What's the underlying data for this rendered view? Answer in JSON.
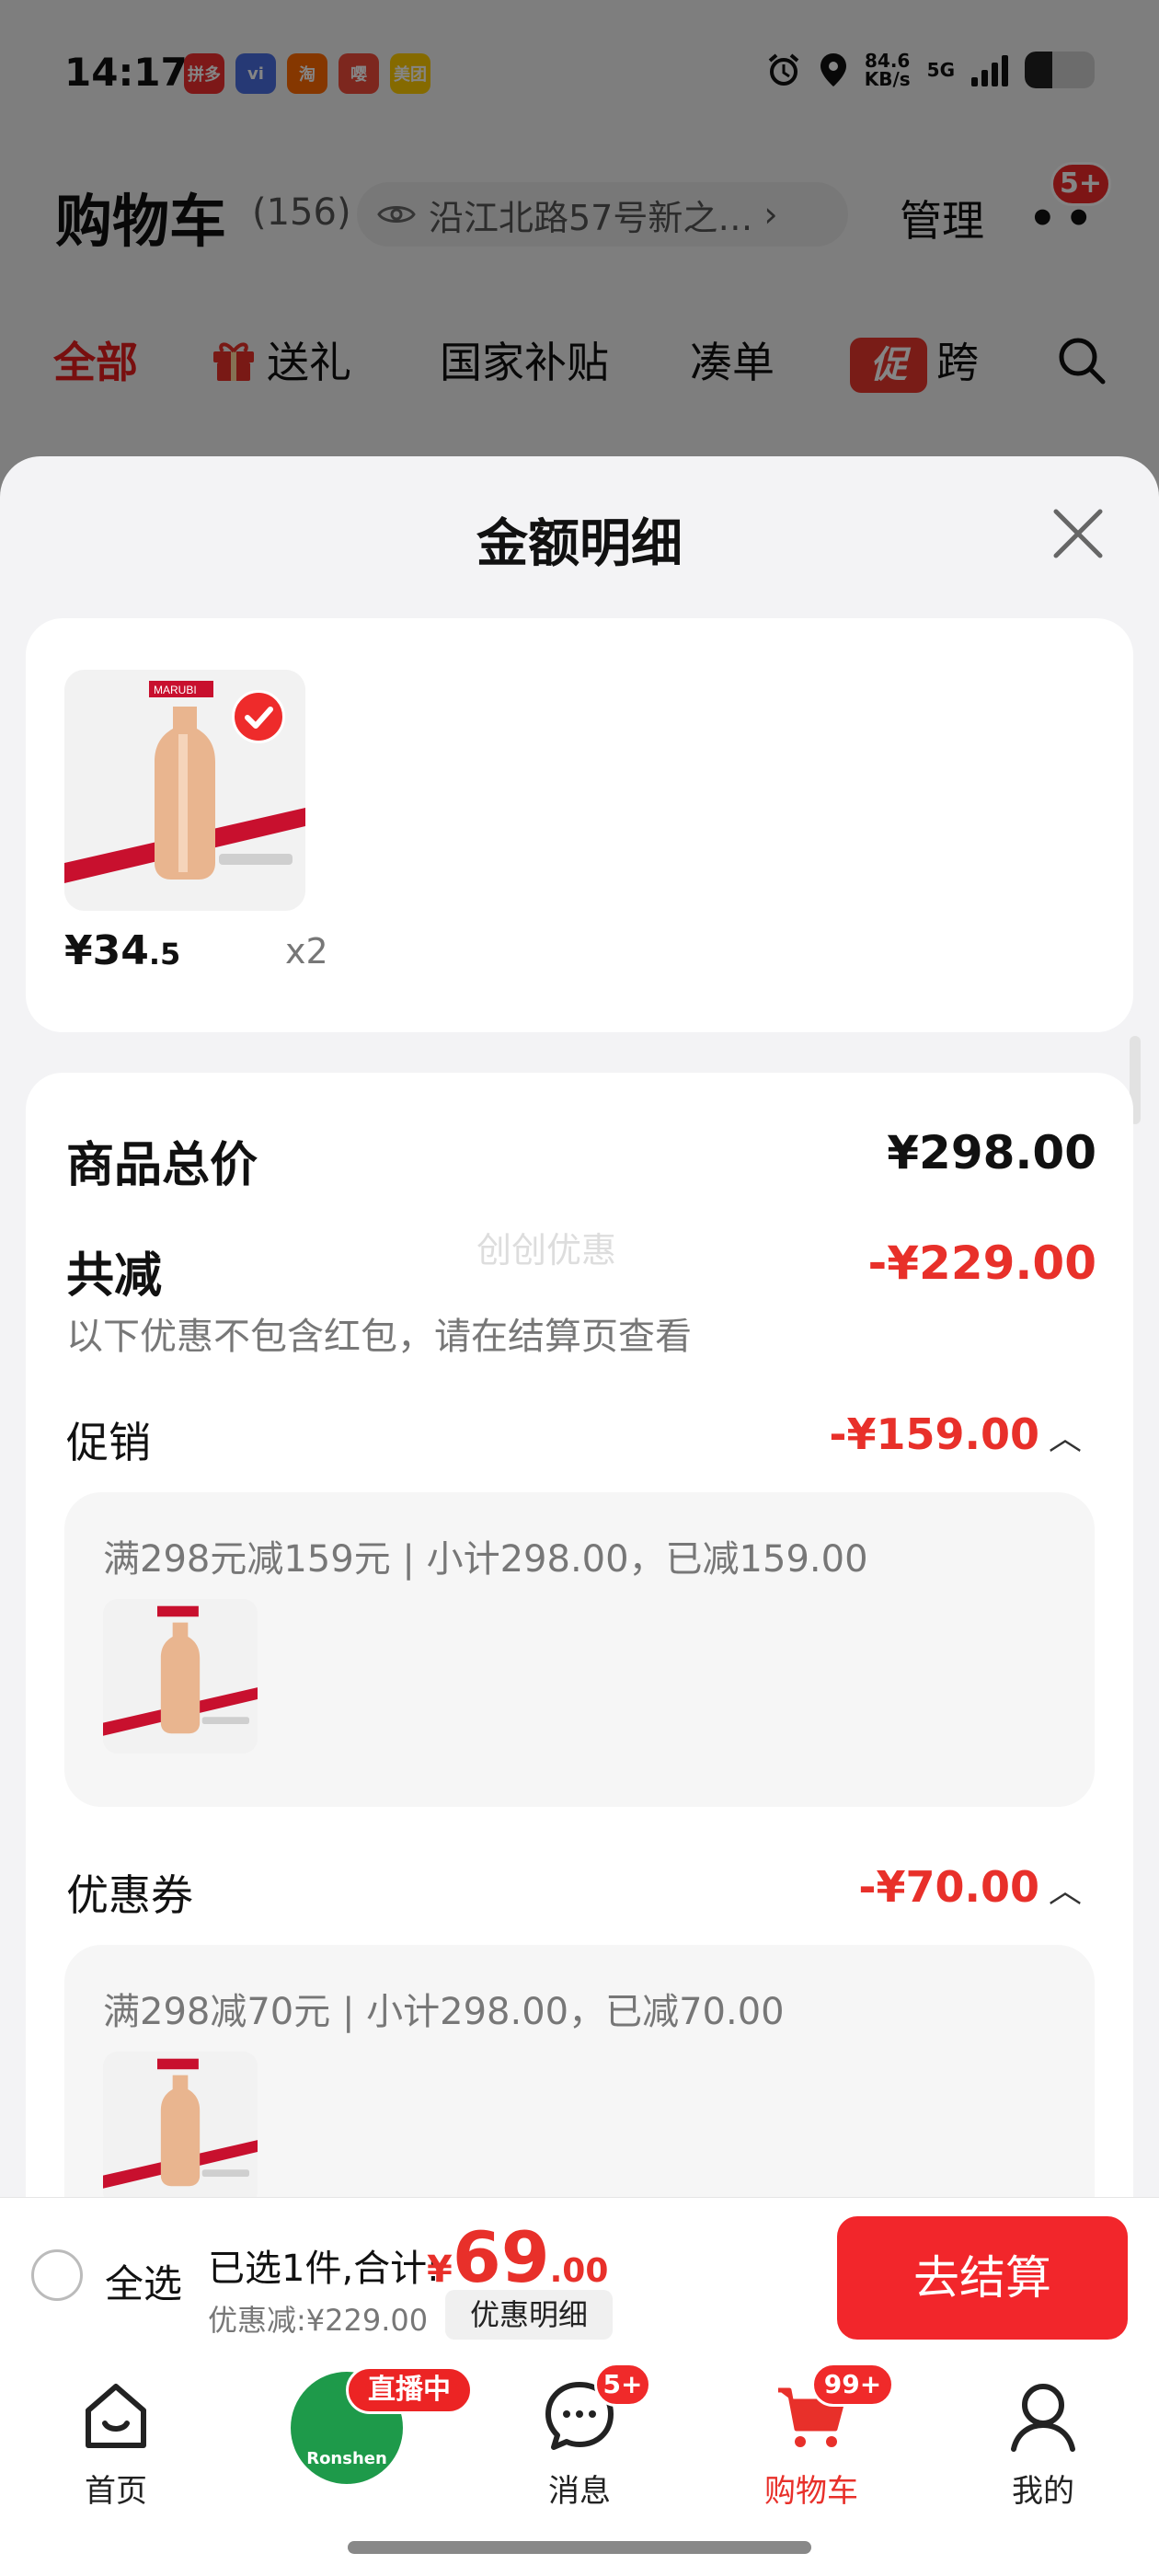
{
  "status_bar": {
    "time": "14:17",
    "apps": [
      {
        "name": "拼多多",
        "color": "#ef2e2e"
      },
      {
        "name": "vivo",
        "color": "#4a6ee0"
      },
      {
        "name": "淘",
        "color": "#ff6a00"
      },
      {
        "name": "嘤",
        "color": "#f04b3a"
      },
      {
        "name": "美团",
        "color": "#ffcc00"
      }
    ],
    "net_speed_value": "84.6",
    "net_speed_unit": "KB/s",
    "network": "5G"
  },
  "cart": {
    "title": "购物车",
    "count": "(156)",
    "address": "沿江北路57号新之…",
    "manage": "管理",
    "more_badge": "5+"
  },
  "categories": [
    {
      "label": "全部",
      "active": true
    },
    {
      "label": "送礼",
      "icon": "gift-icon"
    },
    {
      "label": "国家补贴"
    },
    {
      "label": "凑单"
    },
    {
      "label": "跨",
      "icon": "promo-icon",
      "icon_text": "促"
    }
  ],
  "sheet": {
    "title": "金额明细",
    "product": {
      "price_int": "¥34",
      "price_dec": ".5",
      "qty": "x2",
      "brand": "MARUBI"
    },
    "summary": {
      "total_label": "商品总价",
      "total_value": "¥298.00",
      "reduce_label": "共减",
      "reduce_value": "-¥229.00",
      "reduce_note": "以下优惠不包含红包，请在结算页查看",
      "watermark": "创创优惠"
    },
    "promotion": {
      "label": "促销",
      "value": "-¥159.00",
      "detail": "满298元减159元 | 小计298.00，已减159.00"
    },
    "coupon": {
      "label": "优惠券",
      "value": "-¥70.00",
      "detail": "满298减70元 | 小计298.00，已减70.00"
    }
  },
  "bottom_bar": {
    "select_all": "全选",
    "selected_text": "已选1件,合计:",
    "total_yen": "¥",
    "total_int": "69",
    "total_dec": ".00",
    "discount_text": "优惠减:¥229.00",
    "discount_detail_button": "优惠明细",
    "checkout": "去结算"
  },
  "nav": {
    "home": "首页",
    "live_badge": "直播中",
    "live_brand": "Ronshen",
    "messages": "消息",
    "messages_badge": "5+",
    "cart": "购物车",
    "cart_badge": "99+",
    "mine": "我的"
  },
  "colors": {
    "accent": "#e8302a",
    "checkout": "#f2262b",
    "sheet_bg": "#f3f3f5"
  }
}
